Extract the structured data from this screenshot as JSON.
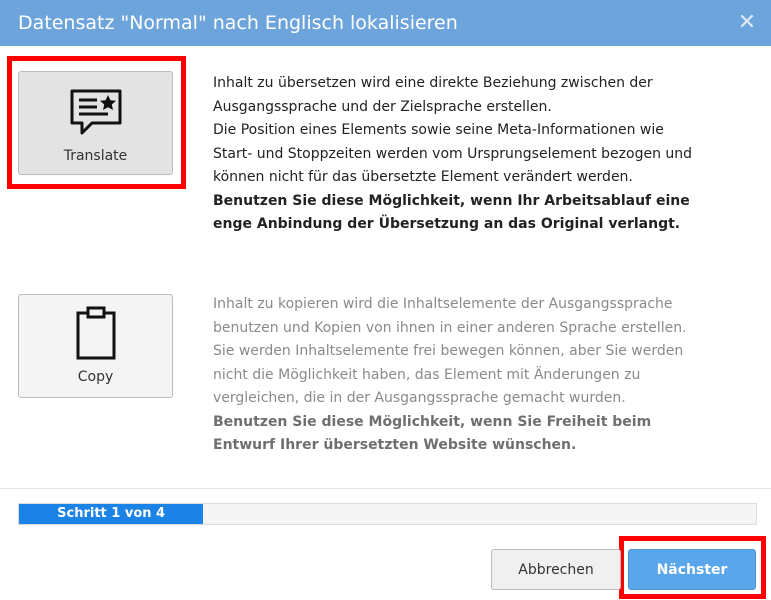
{
  "dialog": {
    "title": "Datensatz \"Normal\" nach Englisch lokalisieren",
    "close_label": "✕"
  },
  "options": {
    "translate": {
      "label": "Translate",
      "icon": "speech-bubble-star-icon",
      "text_lines": [
        "Inhalt zu übersetzen wird eine direkte Beziehung zwischen der",
        "Ausgangssprache und der Zielsprache erstellen.",
        "Die Position eines Elements sowie seine Meta-Informationen wie",
        "Start- und Stoppzeiten werden vom Ursprungselement bezogen und",
        "können nicht für das übersetzte Element verändert werden."
      ],
      "bold_lines": [
        "Benutzen Sie diese Möglichkeit, wenn Ihr Arbeitsablauf eine",
        "enge Anbindung der Übersetzung an das Original verlangt."
      ]
    },
    "copy": {
      "label": "Copy",
      "icon": "clipboard-icon",
      "text_lines": [
        "Inhalt zu kopieren wird die Inhaltselemente der Ausgangssprache",
        "benutzen und Kopien von ihnen in einer anderen Sprache erstellen.",
        "Sie werden Inhaltselemente frei bewegen können, aber Sie werden",
        "nicht die Möglichkeit haben, das Element mit Änderungen zu",
        "vergleichen, die in der Ausgangssprache gemacht wurden."
      ],
      "bold_lines": [
        "Benutzen Sie diese Möglichkeit, wenn Sie Freiheit beim",
        "Entwurf Ihrer übersetzten Website wünschen."
      ]
    }
  },
  "progress": {
    "label": "Schritt 1 von 4",
    "current_step": 1,
    "total_steps": 4
  },
  "footer": {
    "cancel_label": "Abbrechen",
    "next_label": "Nächster"
  },
  "colors": {
    "title_bar": "#6da4dc",
    "progress_fill": "#1c83e6",
    "next_button": "#5aa6ea",
    "highlight": "#ff0000"
  }
}
